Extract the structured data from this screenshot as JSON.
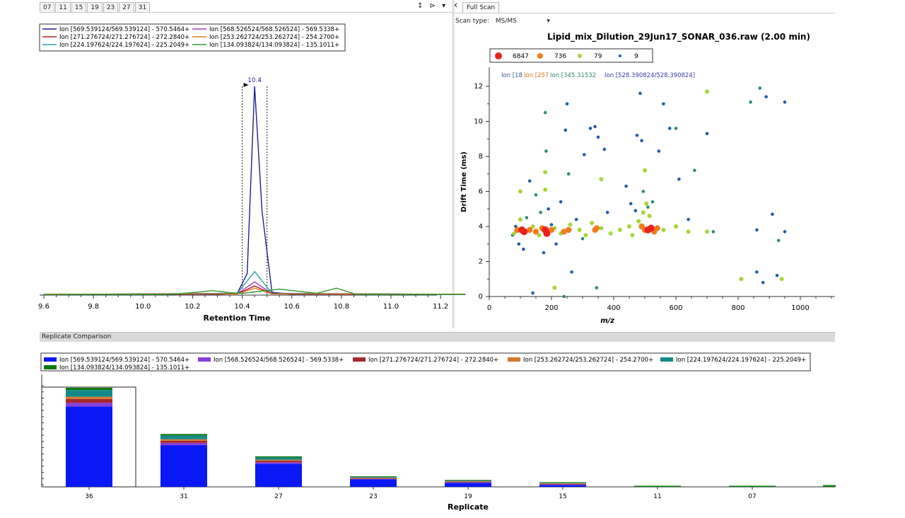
{
  "left_tabs": [
    "07",
    "11",
    "15",
    "19",
    "23",
    "27",
    "31"
  ],
  "pane_controls": "↕ ⊳ ▾ ✕",
  "chromatogram": {
    "legend": [
      {
        "label": "Ion [569.539124/569.539124] - 570.5464+",
        "color": "#1f1f8f"
      },
      {
        "label": "Ion [568.526524/568.526524] - 569.5338+",
        "color": "#a43fc8"
      },
      {
        "label": "Ion [271.276724/271.276724] - 272.2840+",
        "color": "#b22222"
      },
      {
        "label": "Ion [253.262724/253.262724] - 254.2700+",
        "color": "#e07a1f"
      },
      {
        "label": "Ion [224.197624/224.197624] - 225.2049+",
        "color": "#2a9fa8"
      },
      {
        "label": "Ion [134.093824/134.093824] - 135.1011+",
        "color": "#2e9a2e"
      }
    ],
    "peak_label": "10.4",
    "xlabel": "Retention Time",
    "xticks": [
      "9.6",
      "9.8",
      "10.0",
      "10.2",
      "10.4",
      "10.6",
      "10.8",
      "11.0",
      "11.2"
    ]
  },
  "full_scan": {
    "tab_label": "Full Scan",
    "scan_type_label": "Scan type:",
    "scan_type_value": "MS/MS",
    "title": "Lipid_mix_Dilution_29Jun17_SONAR_036.raw  (2.00 min)",
    "legend": [
      {
        "label": "6847",
        "color": "#e8231e"
      },
      {
        "label": "736",
        "color": "#f07c1c"
      },
      {
        "label": "79",
        "color": "#a8d43a"
      },
      {
        "label": "9",
        "color": "#1f5fa8"
      }
    ],
    "ion_labels": [
      {
        "text": "Ion [18",
        "color": "#3c5a8a"
      },
      {
        "text": "Ion [257",
        "color": "#e07a1f"
      },
      {
        "text": "Ion [345.31532",
        "color": "#2a8a70"
      },
      {
        "text": "Ion [528.390824/528.390824]",
        "color": "#3a3ab0"
      }
    ]
  },
  "chart_data": [
    {
      "type": "line",
      "xlabel": "Retention Time",
      "ylabel": "",
      "xlim": [
        9.6,
        11.3
      ],
      "series": [
        {
          "name": "Ion [569.539124/569.539124] - 570.5464+",
          "x": [
            9.6,
            10.3,
            10.38,
            10.42,
            10.45,
            10.48,
            10.52,
            10.6,
            11.3
          ],
          "y": [
            0,
            0,
            0.5,
            10,
            100,
            40,
            1,
            0,
            0
          ]
        },
        {
          "name": "Ion [224.197624/224.197624] - 225.2049+",
          "x": [
            9.6,
            10.38,
            10.45,
            10.52,
            11.3
          ],
          "y": [
            0,
            0.5,
            11,
            0.5,
            0
          ]
        },
        {
          "name": "Ion [568.526524/568.526524] - 569.5338+",
          "x": [
            9.6,
            10.38,
            10.45,
            10.52,
            11.3
          ],
          "y": [
            0,
            0.3,
            6,
            0.3,
            0
          ]
        },
        {
          "name": "Ion [271.276724/271.276724] - 272.2840+",
          "x": [
            9.6,
            10.38,
            10.45,
            10.52,
            11.3
          ],
          "y": [
            0,
            0.3,
            4,
            0.3,
            0
          ]
        },
        {
          "name": "Ion [253.262724/253.262724] - 254.2700+",
          "x": [
            9.6,
            10.38,
            10.45,
            10.52,
            11.3
          ],
          "y": [
            0,
            0.2,
            3,
            0.2,
            0
          ]
        },
        {
          "name": "Ion [134.093824/134.093824] - 135.1011+",
          "x": [
            9.6,
            10.1,
            10.2,
            10.28,
            10.35,
            10.4,
            10.55,
            10.7,
            10.78,
            10.86,
            11.3
          ],
          "y": [
            0,
            0,
            0.8,
            1.8,
            0.8,
            0.5,
            2.5,
            0.5,
            3,
            0,
            0
          ]
        }
      ]
    },
    {
      "type": "scatter",
      "title": "Lipid_mix_Dilution_29Jun17_SONAR_036.raw  (2.00 min)",
      "xlabel": "m/z",
      "ylabel": "Drift Time (ms)",
      "xlim": [
        0,
        1050
      ],
      "ylim": [
        0,
        13
      ],
      "xticks": [
        0,
        200,
        400,
        600,
        800,
        1000
      ],
      "yticks": [
        0,
        2,
        4,
        6,
        8,
        10,
        12
      ],
      "points": [
        [
          105,
          3.8,
          6847
        ],
        [
          112,
          3.7,
          6847
        ],
        [
          180,
          3.8,
          6847
        ],
        [
          185,
          3.6,
          6847
        ],
        [
          510,
          3.8,
          6847
        ],
        [
          520,
          3.9,
          6847
        ],
        [
          90,
          3.8,
          736
        ],
        [
          130,
          3.8,
          736
        ],
        [
          150,
          3.7,
          736
        ],
        [
          170,
          3.9,
          736
        ],
        [
          200,
          3.8,
          736
        ],
        [
          240,
          3.7,
          736
        ],
        [
          255,
          3.8,
          736
        ],
        [
          340,
          3.8,
          736
        ],
        [
          345,
          3.9,
          736
        ],
        [
          490,
          4.0,
          736
        ],
        [
          500,
          3.8,
          736
        ],
        [
          530,
          3.7,
          736
        ],
        [
          540,
          3.9,
          736
        ],
        [
          80,
          3.6,
          79
        ],
        [
          100,
          4.4,
          79
        ],
        [
          140,
          4.0,
          79
        ],
        [
          160,
          3.5,
          79
        ],
        [
          210,
          3.9,
          79
        ],
        [
          230,
          3.6,
          79
        ],
        [
          260,
          4.1,
          79
        ],
        [
          290,
          3.8,
          79
        ],
        [
          310,
          3.5,
          79
        ],
        [
          330,
          4.2,
          79
        ],
        [
          360,
          3.9,
          79
        ],
        [
          390,
          3.6,
          79
        ],
        [
          420,
          3.8,
          79
        ],
        [
          450,
          4.0,
          79
        ],
        [
          460,
          3.5,
          79
        ],
        [
          480,
          4.3,
          79
        ],
        [
          495,
          4.8,
          79
        ],
        [
          505,
          5.3,
          79
        ],
        [
          515,
          4.6,
          79
        ],
        [
          560,
          3.8,
          79
        ],
        [
          600,
          4.0,
          79
        ],
        [
          640,
          3.7,
          79
        ],
        [
          700,
          11.7,
          79
        ],
        [
          700,
          3.7,
          79
        ],
        [
          810,
          1.0,
          79
        ],
        [
          940,
          1.0,
          79
        ],
        [
          180,
          6.1,
          79
        ],
        [
          180,
          7.1,
          79
        ],
        [
          100,
          6.0,
          79
        ],
        [
          360,
          6.7,
          79
        ],
        [
          500,
          7.2,
          79
        ],
        [
          210,
          0.5,
          79
        ],
        [
          75,
          3.5,
          9
        ],
        [
          85,
          4.0,
          9
        ],
        [
          95,
          3.0,
          9
        ],
        [
          110,
          2.7,
          9
        ],
        [
          120,
          4.5,
          9
        ],
        [
          130,
          6.6,
          9
        ],
        [
          140,
          0.2,
          9
        ],
        [
          150,
          5.8,
          9
        ],
        [
          165,
          4.8,
          9
        ],
        [
          175,
          2.5,
          9
        ],
        [
          180,
          10.5,
          9
        ],
        [
          183,
          8.3,
          9
        ],
        [
          190,
          5.0,
          9
        ],
        [
          200,
          4.1,
          9
        ],
        [
          215,
          3.0,
          9
        ],
        [
          230,
          5.4,
          9
        ],
        [
          240,
          0.0,
          9
        ],
        [
          245,
          9.5,
          9
        ],
        [
          250,
          11.0,
          9
        ],
        [
          255,
          7.0,
          9
        ],
        [
          265,
          1.4,
          9
        ],
        [
          280,
          4.4,
          9
        ],
        [
          300,
          3.3,
          9
        ],
        [
          305,
          8.1,
          9
        ],
        [
          325,
          9.6,
          9
        ],
        [
          340,
          9.7,
          9
        ],
        [
          345,
          0.5,
          9
        ],
        [
          350,
          9.1,
          9
        ],
        [
          370,
          8.4,
          9
        ],
        [
          380,
          4.8,
          9
        ],
        [
          440,
          6.3,
          9
        ],
        [
          455,
          5.3,
          9
        ],
        [
          470,
          4.9,
          9
        ],
        [
          475,
          9.2,
          9
        ],
        [
          485,
          11.6,
          9
        ],
        [
          490,
          8.9,
          9
        ],
        [
          495,
          6.0,
          9
        ],
        [
          510,
          5.1,
          9
        ],
        [
          525,
          5.4,
          9
        ],
        [
          545,
          8.3,
          9
        ],
        [
          560,
          11.0,
          9
        ],
        [
          580,
          9.6,
          9
        ],
        [
          600,
          9.6,
          9
        ],
        [
          610,
          6.7,
          9
        ],
        [
          640,
          4.4,
          9
        ],
        [
          660,
          7.2,
          9
        ],
        [
          700,
          9.3,
          9
        ],
        [
          720,
          3.7,
          9
        ],
        [
          840,
          11.1,
          9
        ],
        [
          860,
          3.8,
          9
        ],
        [
          870,
          11.9,
          9
        ],
        [
          890,
          11.4,
          9
        ],
        [
          910,
          4.7,
          9
        ],
        [
          925,
          1.2,
          9
        ],
        [
          930,
          3.2,
          9
        ],
        [
          950,
          11.1,
          9
        ],
        [
          950,
          3.7,
          9
        ],
        [
          880,
          0.8,
          9
        ],
        [
          860,
          1.4,
          9
        ]
      ]
    },
    {
      "type": "bar",
      "xlabel": "Replicate",
      "categories": [
        "36",
        "31",
        "27",
        "23",
        "19",
        "15",
        "11",
        "07"
      ],
      "series": [
        {
          "name": "Ion [569.539124/569.539124] - 570.5464+",
          "color": "#0a18f5",
          "values": [
            108,
            56,
            31,
            10,
            5.5,
            2.5,
            0,
            0
          ]
        },
        {
          "name": "Ion [568.526524/568.526524] - 569.5338+",
          "color": "#8a3fd8",
          "values": [
            5,
            3,
            2,
            0.6,
            0.4,
            0.2,
            0,
            0
          ]
        },
        {
          "name": "Ion [271.276724/271.276724] - 272.2840+",
          "color": "#a52a2a",
          "values": [
            5,
            3,
            2,
            0.4,
            0.3,
            0.2,
            0,
            0
          ]
        },
        {
          "name": "Ion [253.262724/253.262724] - 254.2700+",
          "color": "#d47a2a",
          "values": [
            3,
            2,
            1.5,
            0.3,
            0.2,
            0.1,
            0,
            0
          ]
        },
        {
          "name": "Ion [224.197624/224.197624] - 225.2049+",
          "color": "#138a8a",
          "values": [
            9,
            5,
            3,
            1.2,
            0.5,
            0.3,
            0,
            0
          ]
        },
        {
          "name": "Ion [134.093824/134.093824] - 135.1011+",
          "color": "#0d7a0d",
          "values": [
            3,
            2,
            1.5,
            0.5,
            0.3,
            0.2,
            1.5,
            1.5
          ]
        }
      ]
    }
  ],
  "replicate": {
    "header": "Replicate Comparison",
    "xlabel": "Replicate"
  }
}
